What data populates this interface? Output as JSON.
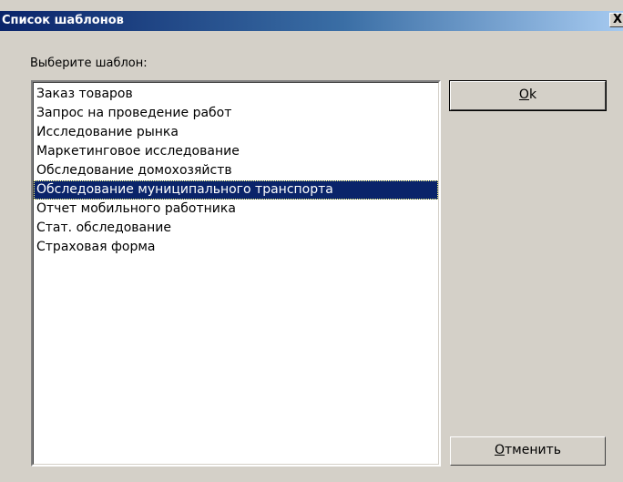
{
  "window": {
    "title": "Список шаблонов",
    "close_glyph": "X"
  },
  "dialog": {
    "prompt": "Выберите шаблон:",
    "selected_index": 5,
    "templates": [
      "Заказ товаров",
      "Запрос на проведение работ",
      "Исследование рынка",
      "Маркетинговое исследование",
      "Обследование домохозяйств",
      "Обследование муниципального транспорта",
      "Отчет мобильного работника",
      "Стат. обследование",
      "Страховая форма"
    ]
  },
  "buttons": {
    "ok": {
      "accel": "O",
      "rest": "k"
    },
    "cancel": {
      "accel": "О",
      "rest": "тменить"
    }
  },
  "colors": {
    "selection": "#0a246a",
    "title_start": "#0a246a",
    "title_end": "#a6caf0",
    "face": "#d4d0c8"
  }
}
